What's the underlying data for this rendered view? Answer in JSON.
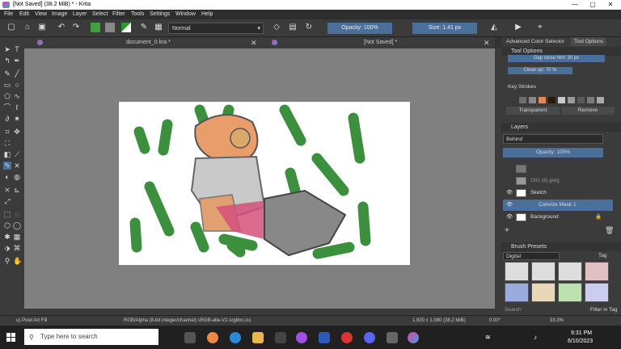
{
  "window": {
    "title": "[Not Saved]  (38.2 MiB)  * - Krita",
    "minimize": "—",
    "maximize": "▢",
    "close": "✕"
  },
  "menu": [
    "File",
    "Edit",
    "View",
    "Image",
    "Layer",
    "Select",
    "Filter",
    "Tools",
    "Settings",
    "Window",
    "Help"
  ],
  "toolbar": {
    "blend_mode": "Normal",
    "opacity": "Opacity: 100%",
    "size": "Size: 1.41 px"
  },
  "tabs": {
    "doc1": "document_0.kra *",
    "doc2": "[Not Saved] *",
    "close": "✕"
  },
  "tool_options": {
    "tab_color_selector": "Advanced Color Selector",
    "tab_tool_options": "Tool Options",
    "title": "Tool Options",
    "gap_close": "Gap close hint: 30 px",
    "clean_up": "Clean up: 70 %",
    "key_strokes": "Key Strokes",
    "transparent": "Transparent",
    "remove": "Remove",
    "swatches": [
      "#3a3a3a",
      "#6e6e6e",
      "#8a8a8a",
      "#e08a5a",
      "#2c1a10",
      "#c8c8c8",
      "#9a9a9a",
      "#5a5a5a",
      "#7a7a7a",
      "#aaaaaa"
    ]
  },
  "layers": {
    "title": "Layers",
    "blend": "Behind",
    "opacity": "Opacity:  100%",
    "items": [
      {
        "name": "",
        "selected": false
      },
      {
        "name": "OIG (6).jpeg",
        "selected": false
      },
      {
        "name": "Sketch",
        "selected": false
      },
      {
        "name": "Colorize Mask 1",
        "selected": true
      },
      {
        "name": "Background",
        "selected": false
      }
    ]
  },
  "brush_presets": {
    "title": "Brush Presets",
    "filter": "Digital",
    "tag": "Tag",
    "search": "Search",
    "filter_in_tag": "Filter in Tag"
  },
  "status": {
    "tool": "u) Pixel Art Fill",
    "color": "RGB/Alpha (8-bit integer/channel)  sRGB-elle-V2-srgbtrc.icc",
    "dims": "1,920 x 1,080 (38.2 MiB)",
    "angle": "0.00°",
    "zoom": "33.3%"
  },
  "taskbar": {
    "search": "Type here to search",
    "time": "9:31 PM",
    "date": "6/10/2023"
  }
}
